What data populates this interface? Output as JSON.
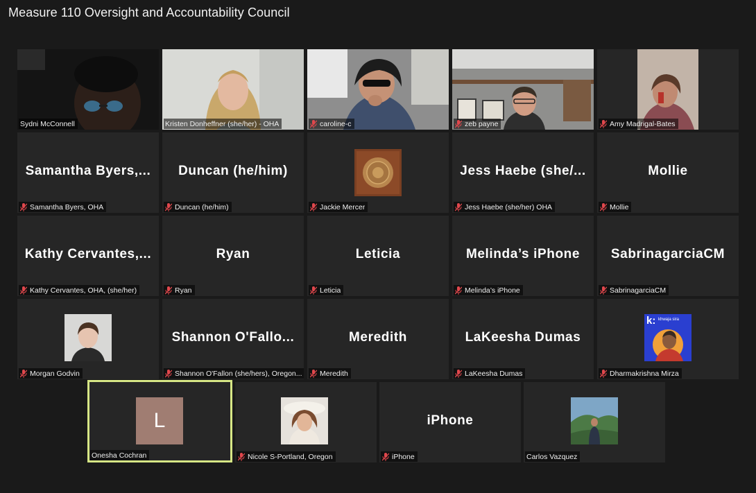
{
  "window": {
    "title": "Measure 110 Oversight and Accountability Council"
  },
  "colors": {
    "background": "#1a1a1a",
    "tile": "#262626",
    "active_speaker_border": "#d6e685",
    "muted_mic": "#e0474c",
    "avatar_l": "#a07d72"
  },
  "participants": [
    {
      "name": "Sydni McConnell",
      "display": "",
      "muted": false
    },
    {
      "name": "Kristen Donheffner (she/her) - OHA",
      "display": "",
      "muted": false
    },
    {
      "name": "caroline-c",
      "display": "",
      "muted": true
    },
    {
      "name": "zeb payne",
      "display": "",
      "muted": true
    },
    {
      "name": "Amy Madrigal-Bates",
      "display": "",
      "muted": true
    },
    {
      "name": "Samantha Byers, OHA",
      "display": "Samantha Byers,...",
      "muted": true
    },
    {
      "name": "Duncan (he/him)",
      "display": "Duncan (he/him)",
      "muted": true
    },
    {
      "name": "Jackie Mercer",
      "display": "",
      "muted": true
    },
    {
      "name": "Jess Haebe (she/her) OHA",
      "display": "Jess Haebe (she/...",
      "muted": true
    },
    {
      "name": "Mollie",
      "display": "Mollie",
      "muted": true
    },
    {
      "name": "Kathy Cervantes, OHA, (she/her)",
      "display": "Kathy Cervantes,...",
      "muted": true
    },
    {
      "name": "Ryan",
      "display": "Ryan",
      "muted": true
    },
    {
      "name": "Leticia",
      "display": "Leticia",
      "muted": true
    },
    {
      "name": "Melinda’s iPhone",
      "display": "Melinda’s iPhone",
      "muted": true
    },
    {
      "name": "SabrinagarciaCM",
      "display": "SabrinagarciaCM",
      "muted": true
    },
    {
      "name": "Morgan Godvin",
      "display": "",
      "muted": true
    },
    {
      "name": "Shannon O'Fallon (she/hers), Oregon...",
      "display": "Shannon O'Fallo...",
      "muted": true
    },
    {
      "name": "Meredith",
      "display": "Meredith",
      "muted": true
    },
    {
      "name": "LaKeesha Dumas",
      "display": "LaKeesha Dumas",
      "muted": true
    },
    {
      "name": "Dharmakrishna Mirza",
      "display": "",
      "muted": true
    },
    {
      "name": "Onesha Cochran",
      "display": "",
      "muted": false,
      "avatar_letter": "L"
    },
    {
      "name": "Nicole S-Portland, Oregon",
      "display": "",
      "muted": true
    },
    {
      "name": "iPhone",
      "display": "iPhone",
      "muted": true
    },
    {
      "name": "Carlos Vazquez",
      "display": "",
      "muted": false
    }
  ],
  "dharma_badge": {
    "letter": "k:",
    "text": "khwaja sira"
  }
}
